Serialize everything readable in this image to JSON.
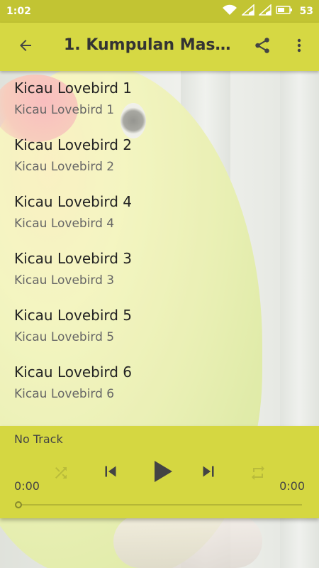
{
  "status_bar": {
    "time": "1:02",
    "battery": "53",
    "icons": [
      "wifi-icon",
      "signal-icon",
      "signal-icon",
      "battery-icon"
    ]
  },
  "app_bar": {
    "title": "1. Kumpulan Maste…",
    "icons": [
      "back-arrow-icon",
      "share-icon",
      "more-vert-icon"
    ]
  },
  "tracks": [
    {
      "title": "Kicau Lovebird 1",
      "subtitle": "Kicau Lovebird 1"
    },
    {
      "title": "Kicau Lovebird 2",
      "subtitle": "Kicau Lovebird 2"
    },
    {
      "title": "Kicau Lovebird 4",
      "subtitle": "Kicau Lovebird 4"
    },
    {
      "title": "Kicau Lovebird 3",
      "subtitle": "Kicau Lovebird 3"
    },
    {
      "title": "Kicau Lovebird 5",
      "subtitle": "Kicau Lovebird 5"
    },
    {
      "title": "Kicau Lovebird 6",
      "subtitle": "Kicau Lovebird 6"
    }
  ],
  "player": {
    "now_playing": "No Track",
    "elapsed": "0:00",
    "duration": "0:00",
    "progress": 0,
    "controls": [
      "shuffle-icon",
      "skip-previous-icon",
      "play-icon",
      "skip-next-icon",
      "repeat-icon"
    ]
  },
  "colors": {
    "status_bar": "#c2c433",
    "app_bar": "#d6d843",
    "player": "#d5d741"
  }
}
